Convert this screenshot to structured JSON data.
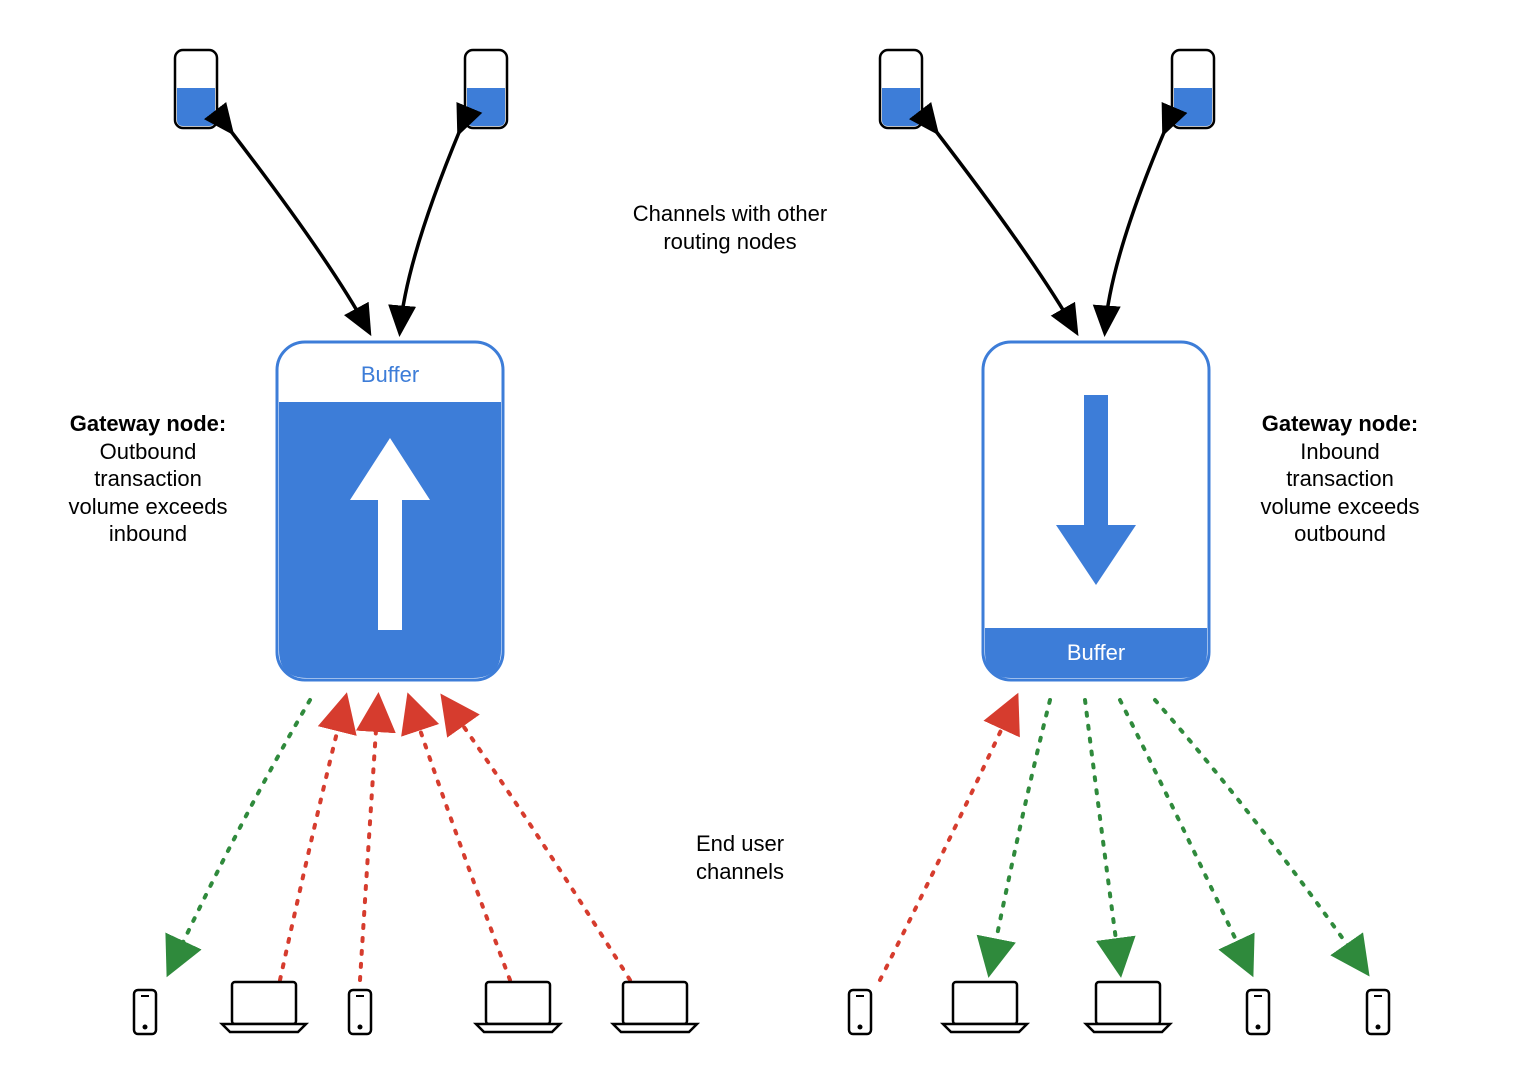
{
  "labels": {
    "channels_routing": {
      "l1": "Channels with other",
      "l2": "routing nodes"
    },
    "end_user_channels": {
      "l1": "End user",
      "l2": "channels"
    },
    "left_node_title": "Gateway node:",
    "left_node_body1": "Outbound",
    "left_node_body2": "transaction",
    "left_node_body3": "volume exceeds",
    "left_node_body4": "inbound",
    "right_node_title": "Gateway node:",
    "right_node_body1": "Inbound",
    "right_node_body2": "transaction",
    "right_node_body3": "volume exceeds",
    "right_node_body4": "outbound",
    "buffer_left": "Buffer",
    "buffer_right": "Buffer"
  },
  "colors": {
    "blue": "#3d7dd8",
    "red": "#d63c2e",
    "green": "#2f8a3c",
    "black": "#000000",
    "white": "#ffffff"
  },
  "left_gateway": {
    "fill_side": "bottom",
    "buffer_side": "top",
    "arrow_direction": "up",
    "arrow_color": "white",
    "user_channels": [
      {
        "color": "green",
        "device": "phone"
      },
      {
        "color": "red",
        "device": "laptop"
      },
      {
        "color": "red",
        "device": "phone"
      },
      {
        "color": "red",
        "device": "laptop"
      },
      {
        "color": "red",
        "device": "laptop"
      }
    ]
  },
  "right_gateway": {
    "fill_side": "bottom_thin",
    "buffer_side": "bottom",
    "arrow_direction": "down",
    "arrow_color": "blue",
    "user_channels": [
      {
        "color": "red",
        "device": "phone"
      },
      {
        "color": "green",
        "device": "laptop"
      },
      {
        "color": "green",
        "device": "laptop"
      },
      {
        "color": "green",
        "device": "phone"
      },
      {
        "color": "green",
        "device": "phone"
      }
    ]
  }
}
